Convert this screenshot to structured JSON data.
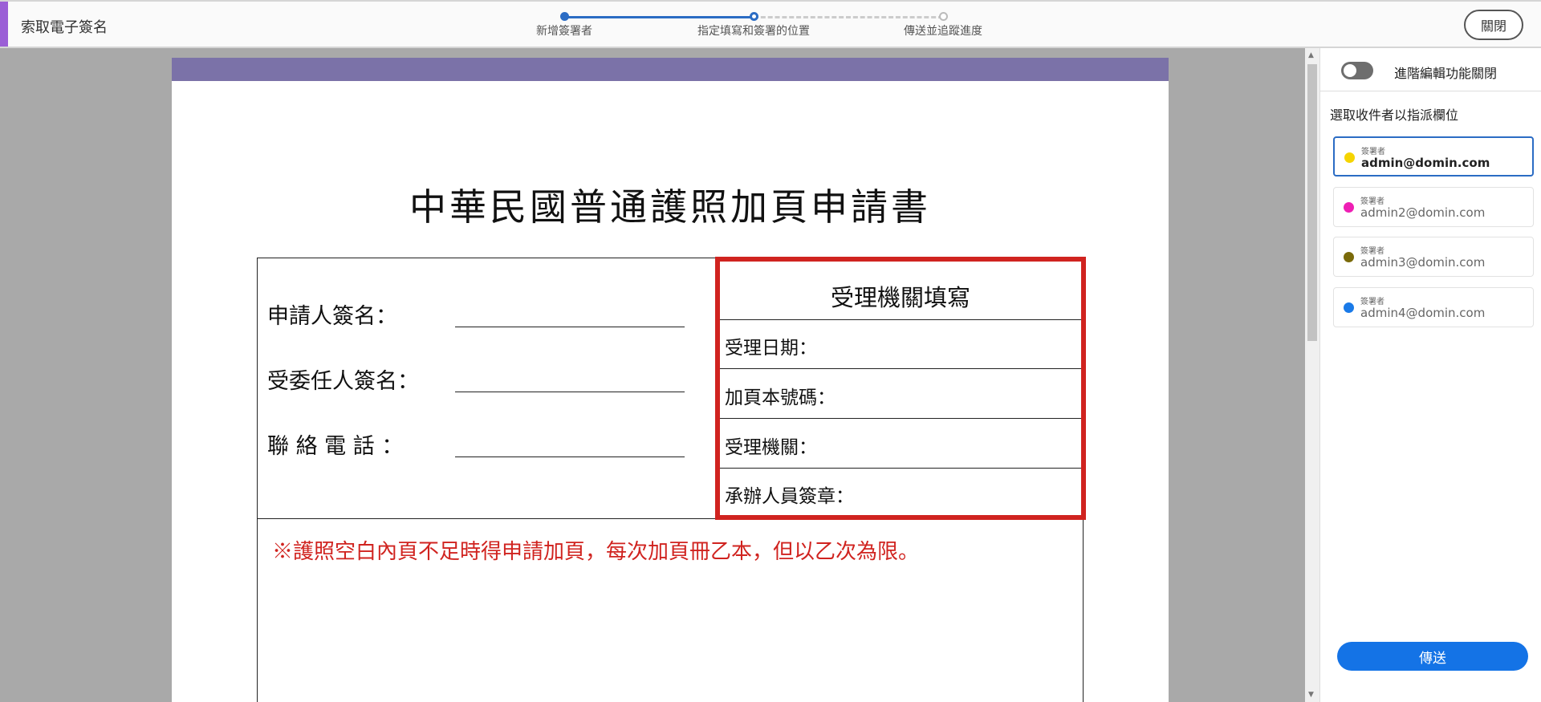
{
  "header": {
    "title": "索取電子簽名",
    "steps": [
      "新增簽署者",
      "指定填寫和簽署的位置",
      "傳送並追蹤進度"
    ],
    "close_label": "關閉"
  },
  "document": {
    "title": "中華民國普通護照加頁申請書",
    "left_labels": [
      "申請人簽名：",
      "受委任人簽名：",
      "聯 絡 電 話 ："
    ],
    "agency_heading": "受理機關填寫",
    "agency_rows": [
      "受理日期：",
      "加頁本號碼：",
      "受理機關：",
      "承辦人員簽章："
    ],
    "note": "※護照空白內頁不足時得申請加頁，每次加頁冊乙本，但以乙次為限。"
  },
  "panel": {
    "toggle_label": "進階編輯功能關閉",
    "assign_heading": "選取收件者以指派欄位",
    "recipients": [
      {
        "role": "簽署者",
        "email": "admin@domin.com",
        "color": "#f5d400"
      },
      {
        "role": "簽署者",
        "email": "admin2@domin.com",
        "color": "#ee1fb4"
      },
      {
        "role": "簽署者",
        "email": "admin3@domin.com",
        "color": "#7a6a0a"
      },
      {
        "role": "簽署者",
        "email": "admin4@domin.com",
        "color": "#1a7ae8"
      }
    ],
    "send_label": "傳送"
  }
}
